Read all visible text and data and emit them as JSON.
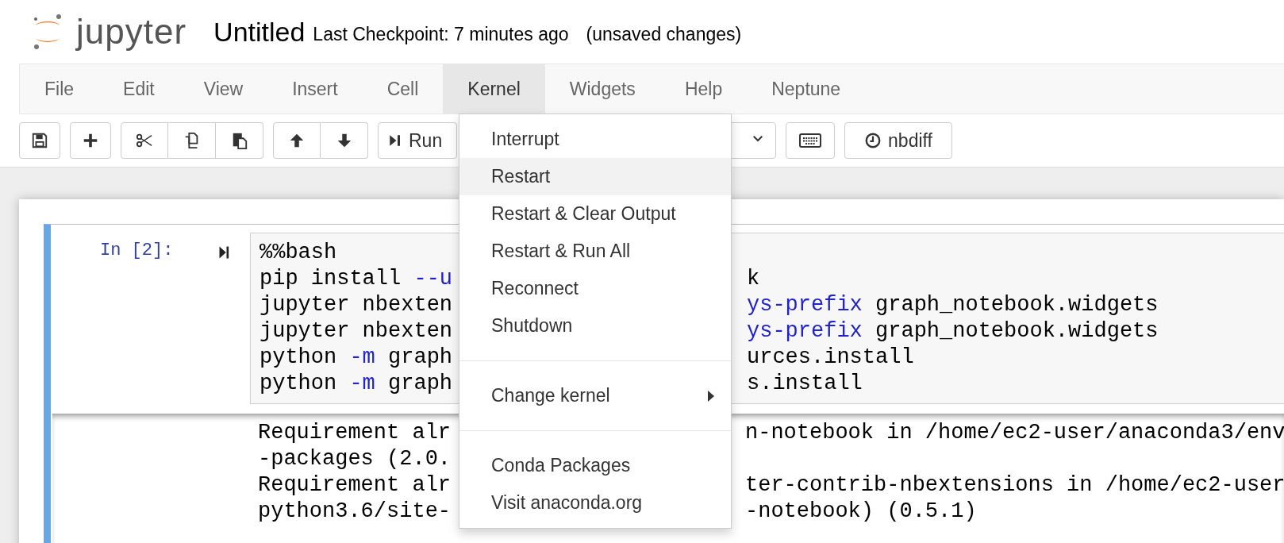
{
  "header": {
    "brand": "jupyter",
    "title": "Untitled",
    "checkpoint": "Last Checkpoint: 7 minutes ago",
    "status": "(unsaved changes)"
  },
  "menubar": [
    {
      "label": "File",
      "selected": false
    },
    {
      "label": "Edit",
      "selected": false
    },
    {
      "label": "View",
      "selected": false
    },
    {
      "label": "Insert",
      "selected": false
    },
    {
      "label": "Cell",
      "selected": false
    },
    {
      "label": "Kernel",
      "selected": true
    },
    {
      "label": "Widgets",
      "selected": false
    },
    {
      "label": "Help",
      "selected": false
    },
    {
      "label": "Neptune",
      "selected": false
    }
  ],
  "toolbar": [
    {
      "buttons": [
        {
          "kind": "save"
        }
      ]
    },
    {
      "buttons": [
        {
          "kind": "add"
        }
      ]
    },
    {
      "buttons": [
        {
          "kind": "cut"
        },
        {
          "kind": "copy"
        },
        {
          "kind": "paste"
        }
      ]
    },
    {
      "buttons": [
        {
          "kind": "up"
        },
        {
          "kind": "down"
        }
      ]
    },
    {
      "buttons": [
        {
          "kind": "run",
          "label": "Run"
        }
      ]
    },
    {
      "buttons": [
        {
          "kind": "select"
        }
      ]
    },
    {
      "buttons": [
        {
          "kind": "keyboard"
        }
      ]
    },
    {
      "buttons": [
        {
          "kind": "nbdiff",
          "label": "nbdiff"
        }
      ]
    }
  ],
  "kernel_menu": [
    {
      "kind": "item",
      "label": "Interrupt",
      "selected": false
    },
    {
      "kind": "item",
      "label": "Restart",
      "selected": true
    },
    {
      "kind": "item",
      "label": "Restart & Clear Output",
      "selected": false
    },
    {
      "kind": "item",
      "label": "Restart & Run All",
      "selected": false
    },
    {
      "kind": "item",
      "label": "Reconnect",
      "selected": false
    },
    {
      "kind": "item",
      "label": "Shutdown",
      "selected": false
    },
    {
      "kind": "divider"
    },
    {
      "kind": "submenu",
      "label": "Change kernel",
      "selected": false
    },
    {
      "kind": "divider"
    },
    {
      "kind": "item",
      "label": "Conda Packages",
      "selected": false
    },
    {
      "kind": "item",
      "label": "Visit anaconda.org",
      "selected": false
    }
  ],
  "cell": {
    "prompt": "In [2]:",
    "code": [
      {
        "left": [
          {
            "text": "%%bash",
            "kind": "plain"
          }
        ]
      },
      {
        "left": [
          {
            "text": "pip install ",
            "kind": "plain"
          },
          {
            "text": "--u",
            "kind": "keyword"
          }
        ],
        "right": [
          {
            "text": "k",
            "kind": "plain"
          }
        ]
      },
      {
        "left": [
          {
            "text": "jupyter nbexten",
            "kind": "plain"
          }
        ],
        "right": [
          {
            "text": "ys-prefix",
            "kind": "keyword"
          },
          {
            "text": " graph_notebook.widgets",
            "kind": "plain"
          }
        ]
      },
      {
        "left": [
          {
            "text": "jupyter nbexten",
            "kind": "plain"
          }
        ],
        "right": [
          {
            "text": "ys-prefix",
            "kind": "keyword"
          },
          {
            "text": " graph_notebook.widgets",
            "kind": "plain"
          }
        ]
      },
      {
        "left": [
          {
            "text": "python ",
            "kind": "plain"
          },
          {
            "text": "-m",
            "kind": "keyword"
          },
          {
            "text": " graph",
            "kind": "plain"
          }
        ],
        "right": [
          {
            "text": "urces.install",
            "kind": "plain"
          }
        ]
      },
      {
        "left": [
          {
            "text": "python ",
            "kind": "plain"
          },
          {
            "text": "-m",
            "kind": "keyword"
          },
          {
            "text": " graph",
            "kind": "plain"
          }
        ],
        "right": [
          {
            "text": "s.install",
            "kind": "plain"
          }
        ]
      }
    ],
    "output": [
      {
        "left": "Requirement alr",
        "right": "n-notebook in /home/ec2-user/anaconda3/env"
      },
      {
        "left": "-packages (2.0."
      },
      {
        "left": "Requirement alr",
        "right": "ter-contrib-nbextensions in /home/ec2-user"
      },
      {
        "left": "python3.6/site-",
        "right": "-notebook) (0.5.1)"
      }
    ]
  }
}
